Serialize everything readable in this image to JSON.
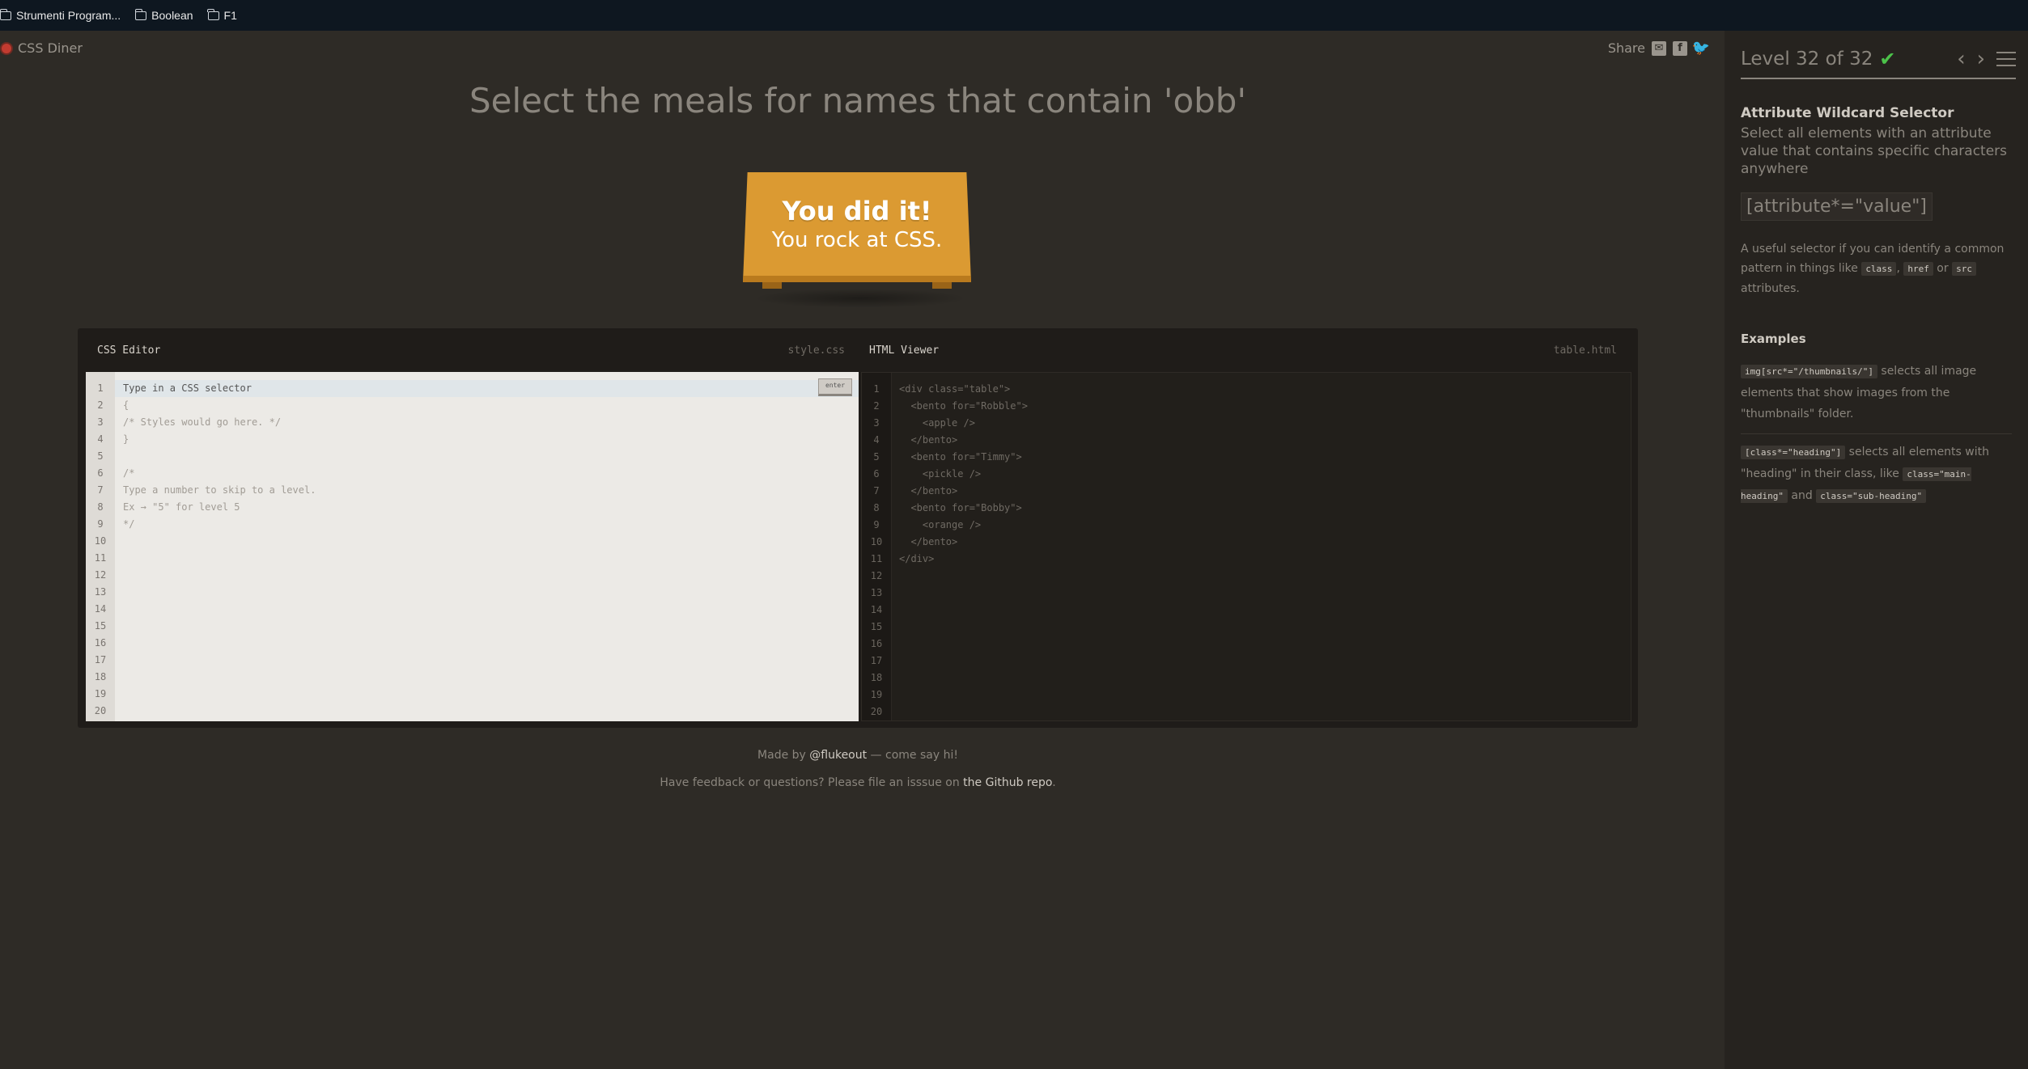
{
  "bookmarks": [
    "Strumenti Program...",
    "Boolean",
    "F1"
  ],
  "header": {
    "logo": "CSS Diner",
    "share": "Share"
  },
  "instruction": "Select the meals for names that contain 'obb'",
  "table_banner": {
    "line1": "You did it!",
    "line2": "You rock at CSS."
  },
  "css_editor": {
    "title": "CSS Editor",
    "file": "style.css",
    "enter_label": "enter",
    "lines": [
      "Type in a CSS selector",
      "{",
      "/* Styles would go here. */",
      "}",
      "",
      "/*",
      "Type a number to skip to a level.",
      "Ex → \"5\" for level 5",
      "*/",
      "",
      "",
      "",
      "",
      "",
      "",
      "",
      "",
      "",
      "",
      ""
    ],
    "line_numbers": [
      "1",
      "2",
      "3",
      "4",
      "5",
      "6",
      "7",
      "8",
      "9",
      "10",
      "11",
      "12",
      "13",
      "14",
      "15",
      "16",
      "17",
      "18",
      "19",
      "20"
    ]
  },
  "html_viewer": {
    "title": "HTML Viewer",
    "file": "table.html",
    "lines": [
      "<div class=\"table\">",
      "  <bento for=\"Robble\">",
      "    <apple />",
      "  </bento>",
      "  <bento for=\"Timmy\">",
      "    <pickle />",
      "  </bento>",
      "  <bento for=\"Bobby\">",
      "    <orange />",
      "  </bento>",
      "</div>",
      "",
      "",
      "",
      "",
      "",
      "",
      "",
      "",
      ""
    ],
    "line_numbers": [
      "1",
      "2",
      "3",
      "4",
      "5",
      "6",
      "7",
      "8",
      "9",
      "10",
      "11",
      "12",
      "13",
      "14",
      "15",
      "16",
      "17",
      "18",
      "19",
      "20"
    ]
  },
  "footer": {
    "made_by_prefix": "Made by ",
    "made_by_link": "@flukeout",
    "made_by_suffix": " — come say hi!",
    "feedback_prefix": "Have feedback or questions? Please file an isssue on ",
    "feedback_link": "the Github repo",
    "feedback_suffix": "."
  },
  "sidebar": {
    "level": "Level 32 of 32",
    "progress": 1.0,
    "selector_name": "Attribute Wildcard Selector",
    "description": "Select all elements with an attribute value that contains specific characters anywhere",
    "syntax": "[attribute*=\"value\"]",
    "hint_prefix": "A useful selector if you can identify a common pattern in things like ",
    "hint_code1": "class",
    "hint_sep1": ", ",
    "hint_code2": "href",
    "hint_sep2": " or ",
    "hint_code3": "src",
    "hint_suffix": " attributes.",
    "examples_title": "Examples",
    "example1_code": "img[src*=\"/thumbnails/\"]",
    "example1_text": " selects all image elements that show images from the \"thumbnails\" folder.",
    "example2_code": "[class*=\"heading\"]",
    "example2_text1": " selects all elements with \"heading\" in their class, like ",
    "example2_code2": "class=\"main-heading\"",
    "example2_text2": " and ",
    "example2_code3": "class=\"sub-heading\""
  },
  "colors": {
    "background": "#2e2b26",
    "sidebar": "#26231f",
    "table": "#db9a32",
    "check": "#4cc24a"
  },
  "icons": [
    "folder-icon",
    "mail-icon",
    "facebook-icon",
    "twitter-icon",
    "check-icon",
    "chevron-left-icon",
    "chevron-right-icon",
    "menu-icon"
  ]
}
